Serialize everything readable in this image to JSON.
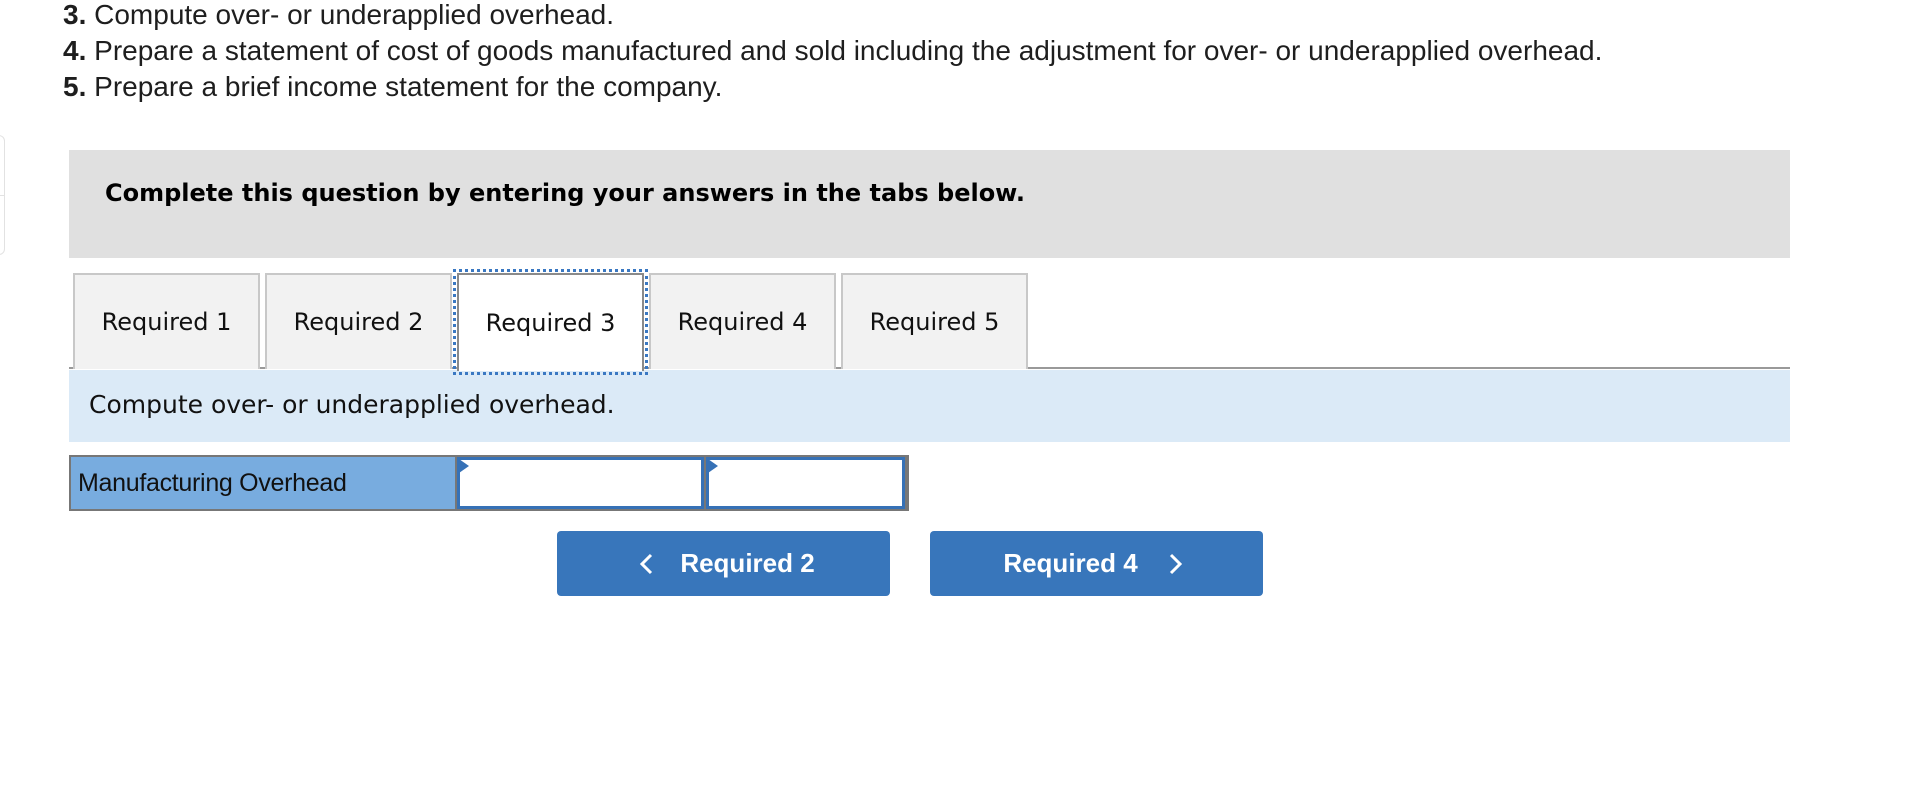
{
  "instructions": [
    {
      "number": "3.",
      "text": "Compute over- or underapplied overhead."
    },
    {
      "number": "4.",
      "text": "Prepare a statement of cost of goods manufactured and sold including the adjustment for over- or underapplied overhead."
    },
    {
      "number": "5.",
      "text": "Prepare a brief income statement for the company."
    }
  ],
  "banner": {
    "text": "Complete this question by entering your answers in the tabs below."
  },
  "tabs": [
    {
      "label": "Required 1",
      "active": false
    },
    {
      "label": "Required 2",
      "active": false
    },
    {
      "label": "Required 3",
      "active": true
    },
    {
      "label": "Required 4",
      "active": false
    },
    {
      "label": "Required 5",
      "active": false
    }
  ],
  "prompt": {
    "text": "Compute over- or underapplied overhead."
  },
  "overhead_table": {
    "label": "Manufacturing Overhead",
    "cell_1_value": "",
    "cell_2_value": ""
  },
  "navigation": {
    "prev_label": "Required 2",
    "next_label": "Required 4",
    "prev_icon": "chevron-left-icon",
    "next_icon": "chevron-right-icon"
  },
  "colors": {
    "accent_blue": "#3876bb",
    "label_cell_blue": "#78acdf",
    "prompt_bar_blue": "#dbeaf7",
    "banner_gray": "#e0e0e0",
    "focus_outline": "#3a78c2"
  }
}
